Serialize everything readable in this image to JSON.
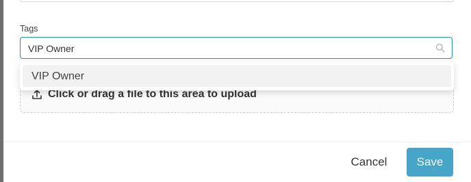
{
  "form": {
    "tags": {
      "label": "Tags",
      "value": "VIP Owner",
      "icon": "search-icon"
    },
    "tags_dropdown": {
      "options": [
        {
          "label": "VIP Owner",
          "highlighted": true
        }
      ]
    },
    "upload": {
      "text": "Click or drag a file to this area to upload",
      "icon": "upload-icon"
    }
  },
  "footer": {
    "cancel_label": "Cancel",
    "save_label": "Save"
  },
  "colors": {
    "accent": "#46a5c8",
    "input_focus_border": "#2b8fae",
    "option_highlight": "#f2f2f2"
  }
}
